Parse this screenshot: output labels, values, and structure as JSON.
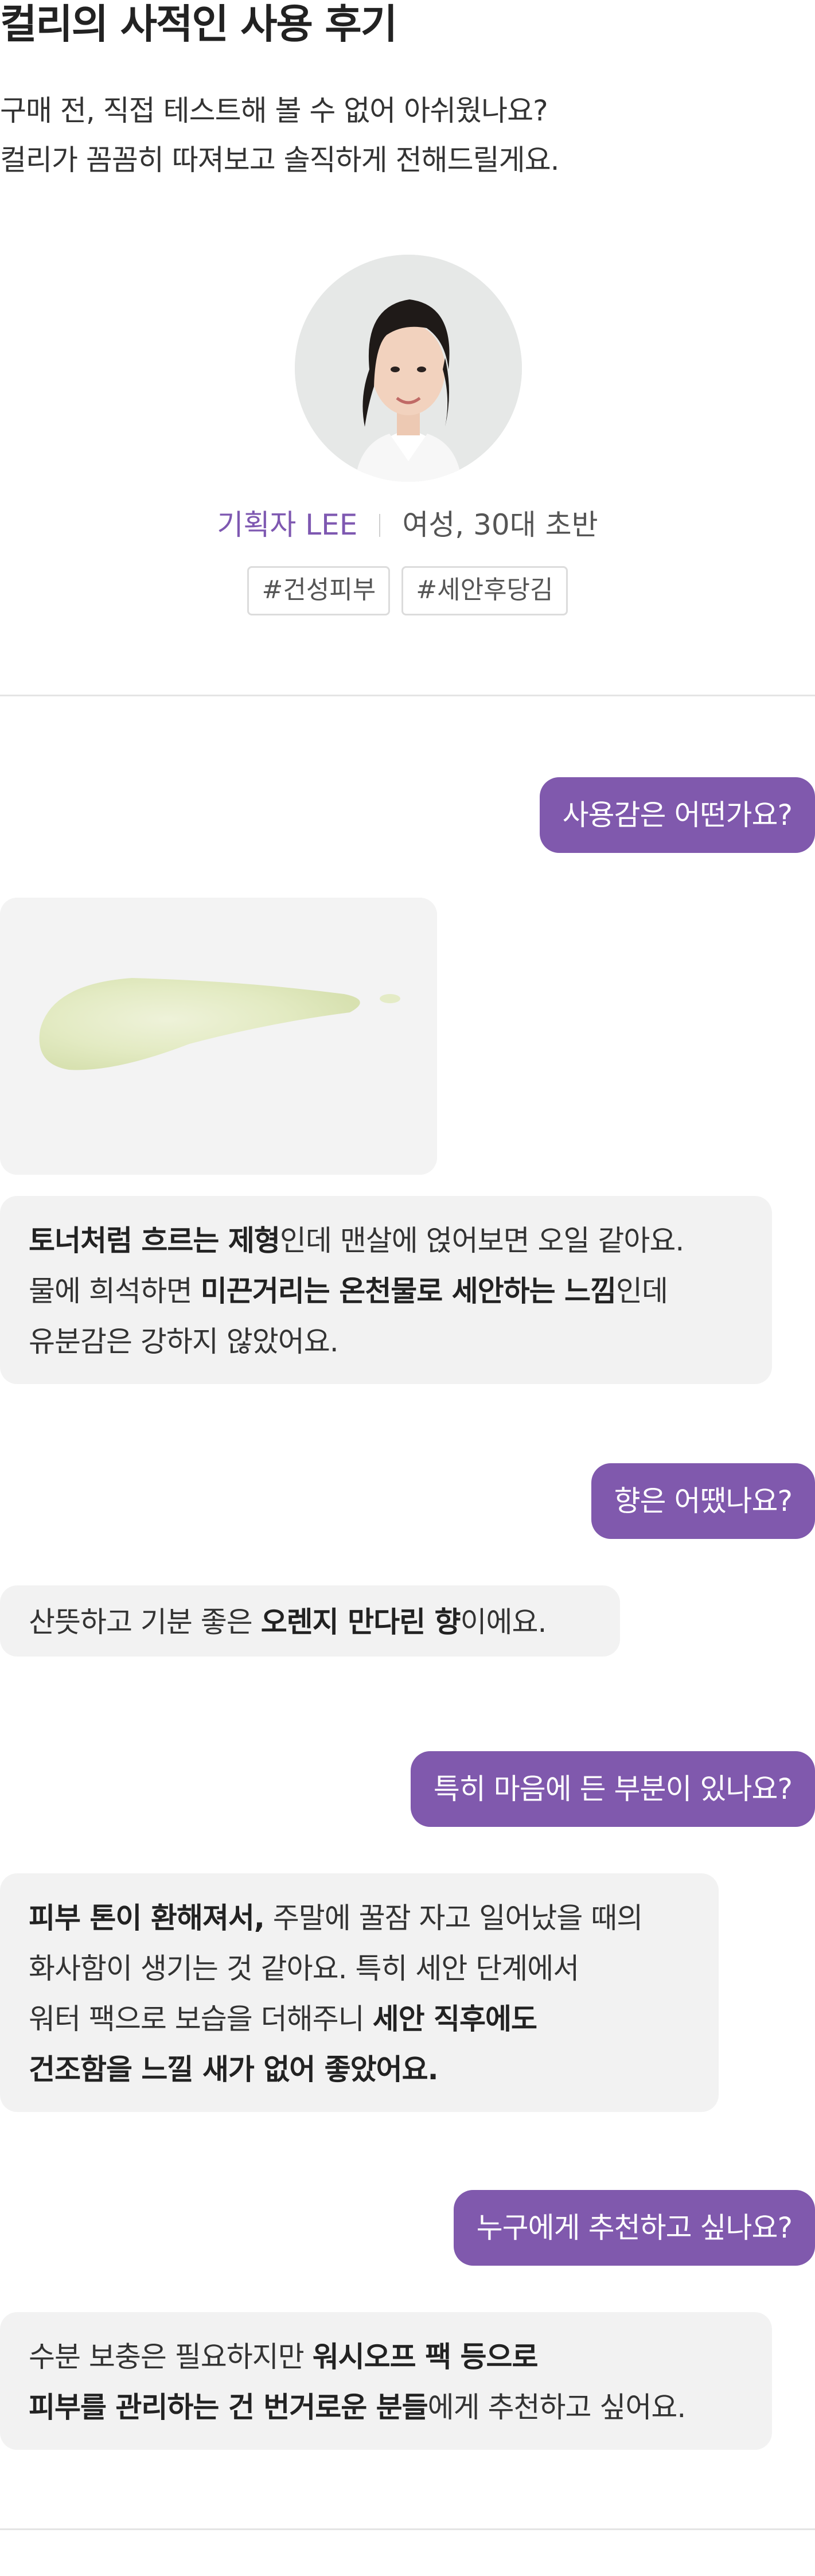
{
  "header": {
    "title": "컬리의 사적인 사용 후기",
    "intro_line1": "구매 전, 직접 테스트해 볼 수 없어 아쉬웠나요?",
    "intro_line2": "컬리가 꼼꼼히 따져보고 솔직하게 전해드릴게요."
  },
  "reviewer": {
    "name": "기획자 LEE",
    "demographic": "여성, 30대 초반",
    "tags": [
      "#건성피부",
      "#세안후당김"
    ]
  },
  "qa": [
    {
      "question": "사용감은 어떤가요?",
      "answer_lines": [
        [
          {
            "t": "토너처럼 흐르는 제형",
            "b": true
          },
          {
            "t": "인데 맨살에 얹어보면 오일 같아요.",
            "b": false
          }
        ],
        [
          {
            "t": "물에 희석하면 ",
            "b": false
          },
          {
            "t": "미끈거리는 온천물로 세안하는 느낌",
            "b": true
          },
          {
            "t": "인데",
            "b": false
          }
        ],
        [
          {
            "t": "유분감은 강하지 않았어요.",
            "b": false
          }
        ]
      ]
    },
    {
      "question": "향은 어땠나요?",
      "answer_lines": [
        [
          {
            "t": "산뜻하고 기분 좋은 ",
            "b": false
          },
          {
            "t": "오렌지 만다린 향",
            "b": true
          },
          {
            "t": "이에요.",
            "b": false
          }
        ]
      ]
    },
    {
      "question": "특히 마음에 든 부분이 있나요?",
      "answer_lines": [
        [
          {
            "t": "피부 톤이 환해져서,",
            "b": true
          },
          {
            "t": " 주말에 꿀잠 자고 일어났을 때의",
            "b": false
          }
        ],
        [
          {
            "t": "화사함이 생기는 것 같아요. 특히 세안 단계에서",
            "b": false
          }
        ],
        [
          {
            "t": "워터 팩으로 보습을 더해주니 ",
            "b": false
          },
          {
            "t": "세안 직후에도",
            "b": true
          }
        ],
        [
          {
            "t": "건조함을 느낄 새가 없어 좋았어요.",
            "b": true
          }
        ]
      ]
    },
    {
      "question": "누구에게 추천하고 싶나요?",
      "answer_lines": [
        [
          {
            "t": "수분 보충은 필요하지만 ",
            "b": false
          },
          {
            "t": "워시오프 팩 등으로",
            "b": true
          }
        ],
        [
          {
            "t": "피부를 관리하는 건 번거로운 분들",
            "b": true
          },
          {
            "t": "에게 추천하고 싶어요.",
            "b": false
          }
        ]
      ]
    }
  ]
}
